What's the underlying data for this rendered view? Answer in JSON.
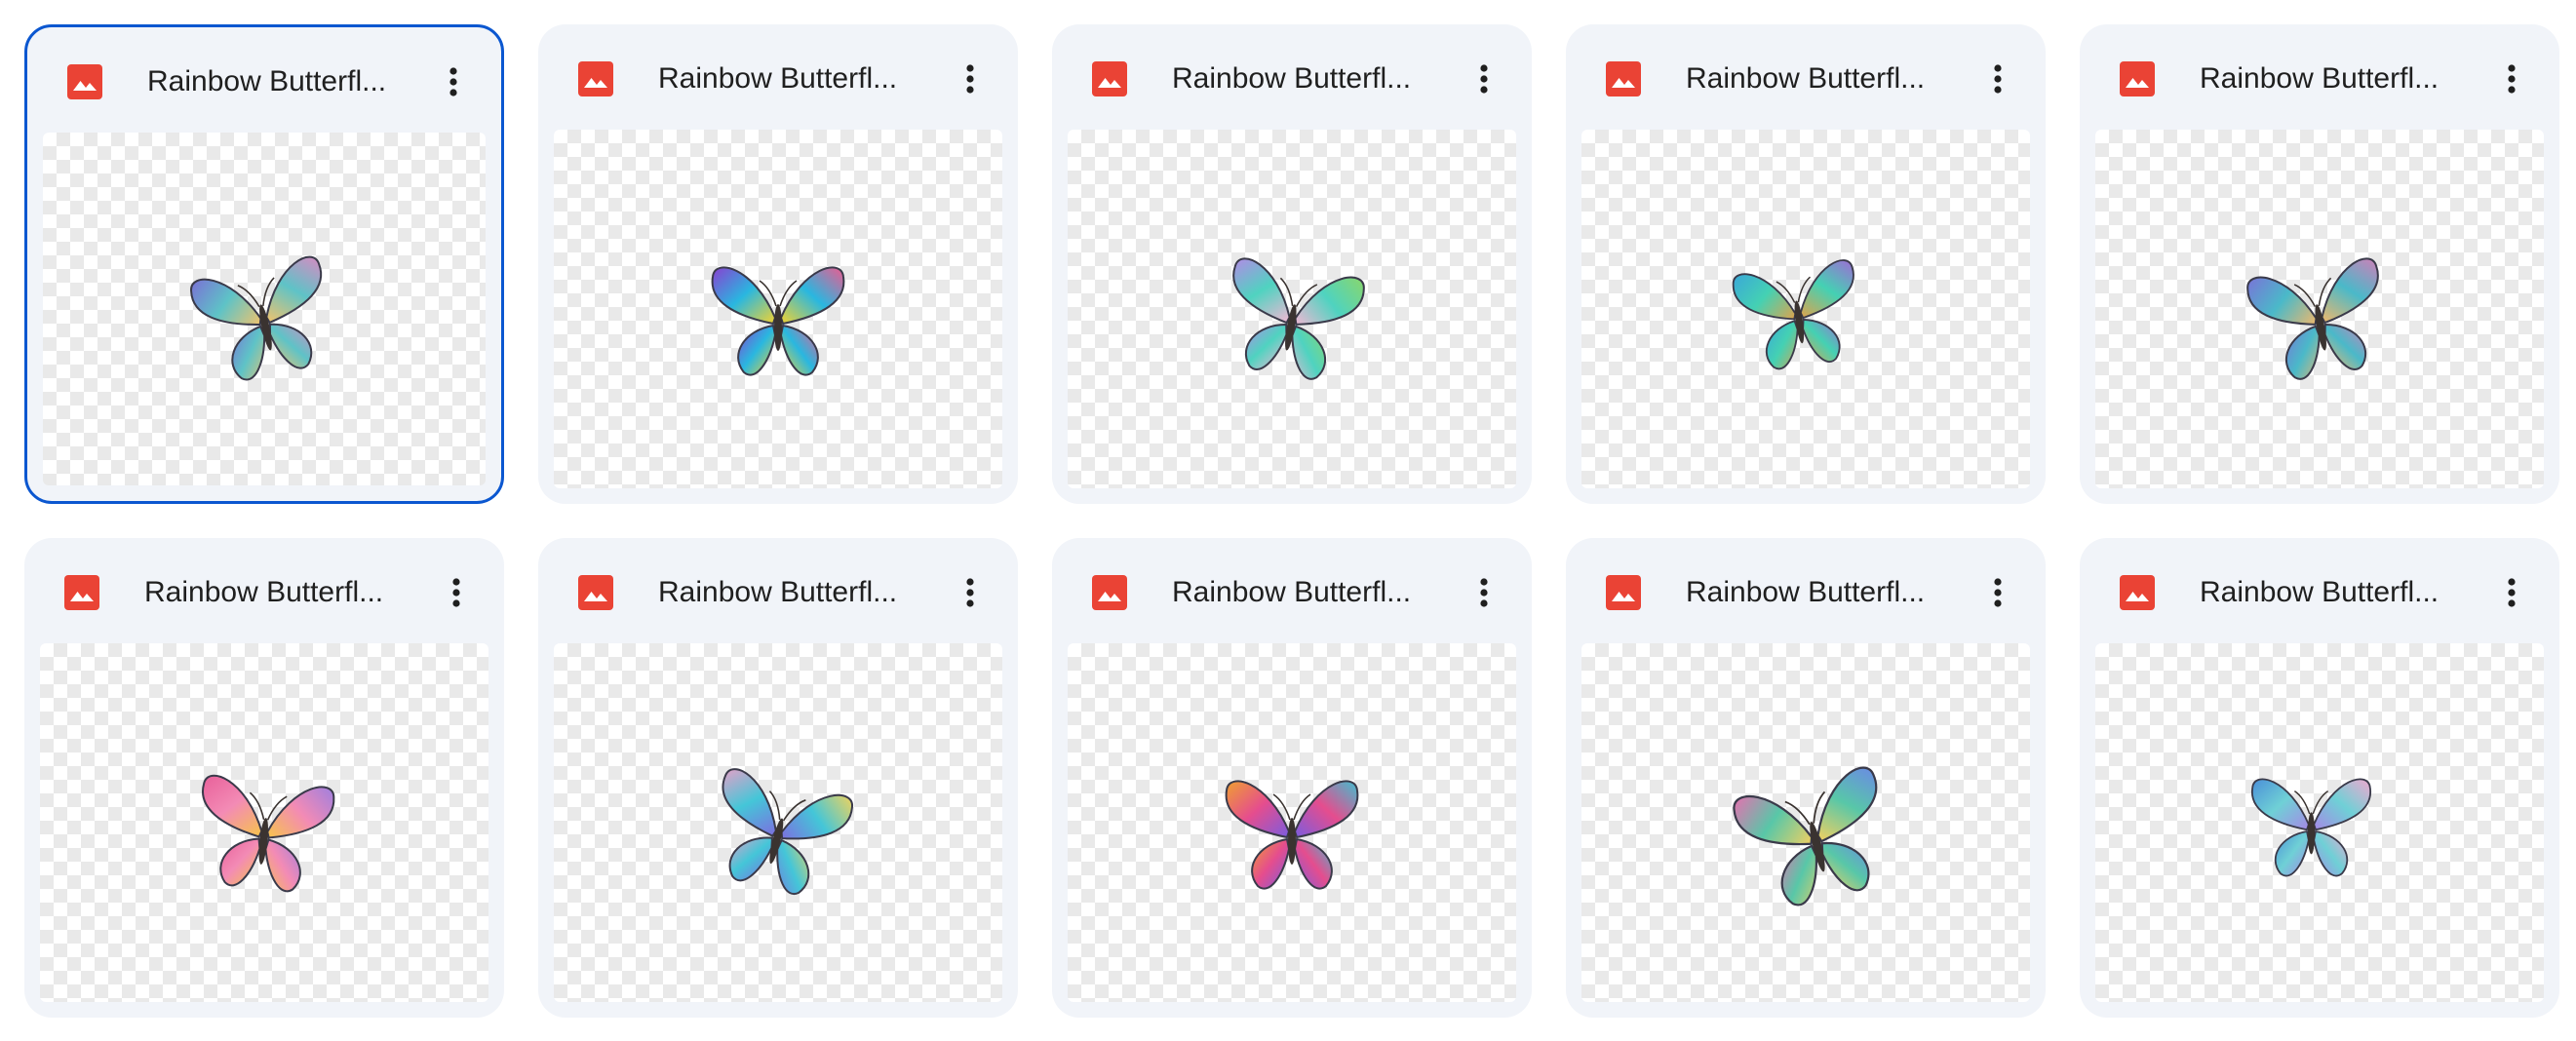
{
  "colors": {
    "card_background": "#f1f4f9",
    "selected_border": "#0b57d0",
    "image_icon": "#ea4335",
    "text": "#1f1f1f"
  },
  "files": [
    {
      "name": "Rainbow Butterfl...",
      "icon": "image-file-icon",
      "selected": true,
      "palette": [
        "#7b6fd6",
        "#5ec3c7",
        "#f2c36b",
        "#d98ac2"
      ]
    },
    {
      "name": "Rainbow Butterfl...",
      "icon": "image-file-icon",
      "selected": false,
      "palette": [
        "#8a3fd1",
        "#29b7e0",
        "#f4d32f",
        "#ef5a8f"
      ]
    },
    {
      "name": "Rainbow Butterfl...",
      "icon": "image-file-icon",
      "selected": false,
      "palette": [
        "#b38ae6",
        "#4fd3c0",
        "#f3b7d4",
        "#8ad66b"
      ]
    },
    {
      "name": "Rainbow Butterfl...",
      "icon": "image-file-icon",
      "selected": false,
      "palette": [
        "#3aa7d9",
        "#44d1b3",
        "#e0a34b",
        "#9f6bd6"
      ]
    },
    {
      "name": "Rainbow Butterfl...",
      "icon": "image-file-icon",
      "selected": false,
      "palette": [
        "#7a73d8",
        "#4ab9c9",
        "#f0b86a",
        "#d07fb8"
      ]
    },
    {
      "name": "Rainbow Butterfl...",
      "icon": "image-file-icon",
      "selected": false,
      "palette": [
        "#e8609a",
        "#f38bb5",
        "#f6c44b",
        "#9e7fe0"
      ]
    },
    {
      "name": "Rainbow Butterfl...",
      "icon": "image-file-icon",
      "selected": false,
      "palette": [
        "#e6a0c8",
        "#44c6d8",
        "#7d6ee0",
        "#f2d35b"
      ]
    },
    {
      "name": "Rainbow Butterfl...",
      "icon": "image-file-icon",
      "selected": false,
      "palette": [
        "#f0a030",
        "#e54d8e",
        "#7a5ce0",
        "#3fbfd0"
      ]
    },
    {
      "name": "Rainbow Butterfl...",
      "icon": "image-file-icon",
      "selected": false,
      "palette": [
        "#e86fb0",
        "#58c7a8",
        "#f3d060",
        "#6b8ae6"
      ]
    },
    {
      "name": "Rainbow Butterfl...",
      "icon": "image-file-icon",
      "selected": false,
      "palette": [
        "#4a8fd8",
        "#6fd0d6",
        "#a688e6",
        "#f1a8cf"
      ]
    }
  ]
}
